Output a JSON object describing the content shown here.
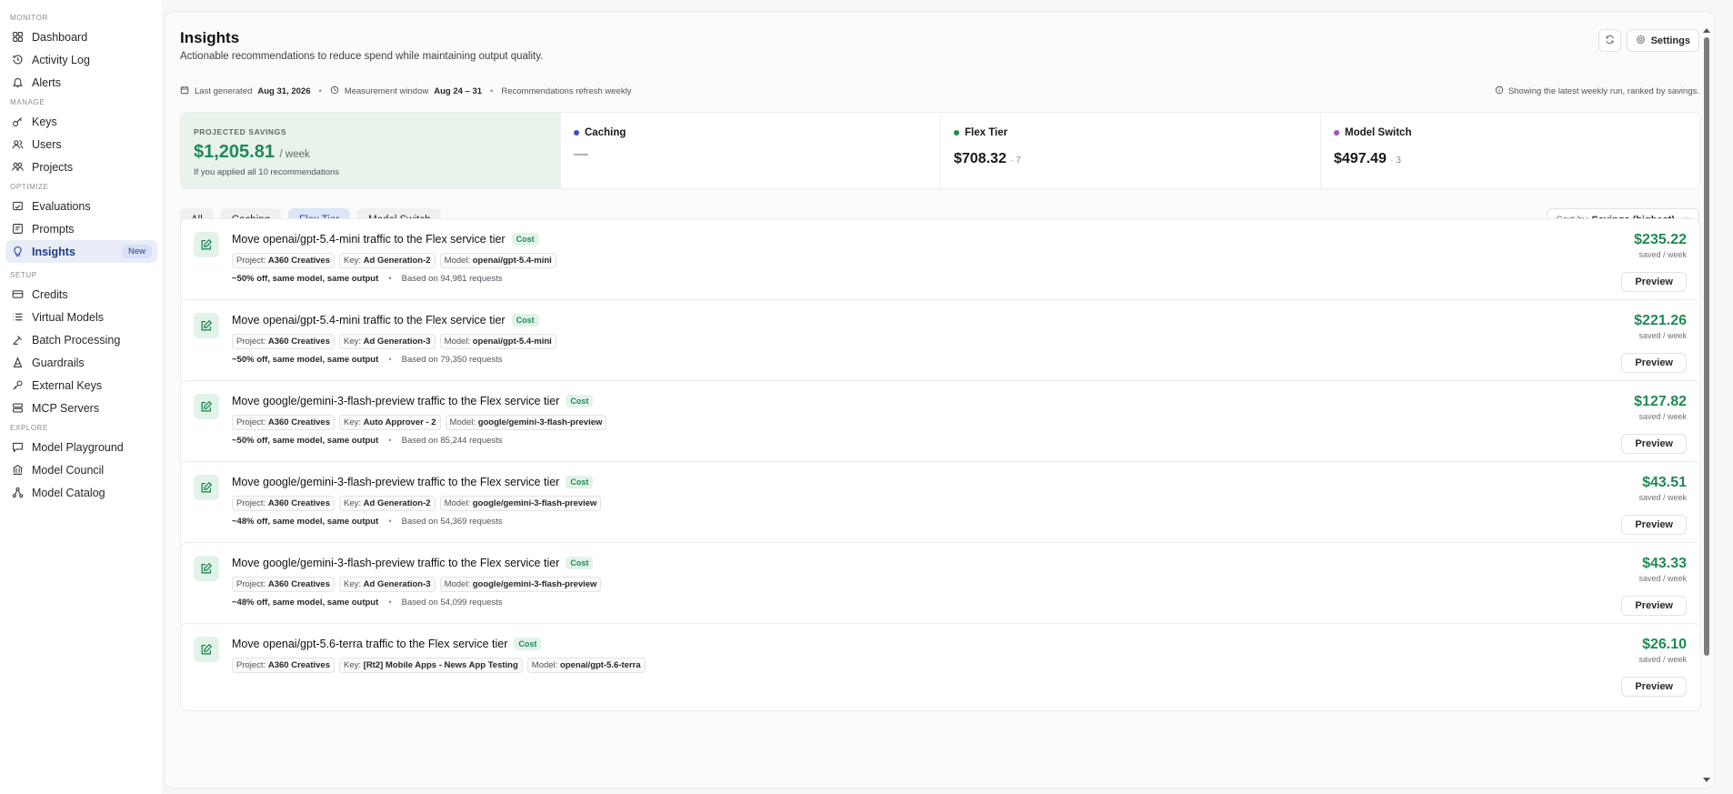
{
  "sidebar": {
    "sections": [
      {
        "title": "MONITOR",
        "items": [
          {
            "label": "Dashboard",
            "icon": "dashboard-icon"
          },
          {
            "label": "Activity Log",
            "icon": "history-icon"
          },
          {
            "label": "Alerts",
            "icon": "bell-icon"
          }
        ]
      },
      {
        "title": "MANAGE",
        "items": [
          {
            "label": "Keys",
            "icon": "key-icon"
          },
          {
            "label": "Users",
            "icon": "users-icon"
          },
          {
            "label": "Projects",
            "icon": "projects-icon"
          }
        ]
      },
      {
        "title": "OPTIMIZE",
        "items": [
          {
            "label": "Evaluations",
            "icon": "evaluations-icon"
          },
          {
            "label": "Prompts",
            "icon": "prompts-icon"
          },
          {
            "label": "Insights",
            "icon": "lightbulb-icon",
            "badge": "New",
            "active": true
          }
        ]
      },
      {
        "title": "SETUP",
        "items": [
          {
            "label": "Credits",
            "icon": "credit-card-icon"
          },
          {
            "label": "Virtual Models",
            "icon": "list-icon"
          },
          {
            "label": "Batch Processing",
            "icon": "batch-icon"
          },
          {
            "label": "Guardrails",
            "icon": "guardrails-icon"
          },
          {
            "label": "External Keys",
            "icon": "external-key-icon"
          },
          {
            "label": "MCP Servers",
            "icon": "server-icon"
          }
        ]
      },
      {
        "title": "EXPLORE",
        "items": [
          {
            "label": "Model Playground",
            "icon": "chat-icon"
          },
          {
            "label": "Model Council",
            "icon": "council-icon"
          },
          {
            "label": "Model Catalog",
            "icon": "catalog-icon"
          }
        ]
      }
    ]
  },
  "header": {
    "title": "Insights",
    "subtitle": "Actionable recommendations to reduce spend while maintaining output quality.",
    "settings_label": "Settings"
  },
  "meta": {
    "last_generated_label": "Last generated",
    "last_generated_value": "Aug 31, 2026",
    "window_label": "Measurement window",
    "window_value": "Aug 24 – 31",
    "refresh_note": "Recommendations refresh weekly",
    "right_note": "Showing the latest weekly run, ranked by savings."
  },
  "summary": {
    "projected_label": "PROJECTED SAVINGS",
    "projected_value": "$1,205.81",
    "projected_unit": "/ week",
    "projected_note": "If you applied all 10 recommendations",
    "categories": [
      {
        "name": "Caching",
        "value": "—",
        "count": "",
        "color": "#3b4fc4"
      },
      {
        "name": "Flex Tier",
        "value": "$708.32",
        "count": "· 7",
        "color": "#1f8a54"
      },
      {
        "name": "Model Switch",
        "value": "$497.49",
        "count": "· 3",
        "color": "#a34fc7"
      }
    ]
  },
  "tabs": [
    {
      "label": "All"
    },
    {
      "label": "Caching"
    },
    {
      "label": "Flex Tier",
      "active": true
    },
    {
      "label": "Model Switch"
    }
  ],
  "sort": {
    "prefix": "Sort by",
    "value": "Savings (highest)"
  },
  "recommendations": [
    {
      "title": "Move openai/gpt-5.4-mini traffic to the Flex service tier",
      "badge": "Cost",
      "project": "A360 Creatives",
      "key": "Ad Generation-2",
      "model": "openai/gpt-5.4-mini",
      "note": "~50% off, same model, same output",
      "based_on": "Based on 94,981 requests",
      "saved": "$235.22",
      "saved_unit": "saved / week",
      "preview": "Preview"
    },
    {
      "title": "Move openai/gpt-5.4-mini traffic to the Flex service tier",
      "badge": "Cost",
      "project": "A360 Creatives",
      "key": "Ad Generation-3",
      "model": "openai/gpt-5.4-mini",
      "note": "~50% off, same model, same output",
      "based_on": "Based on 79,350 requests",
      "saved": "$221.26",
      "saved_unit": "saved / week",
      "preview": "Preview"
    },
    {
      "title": "Move google/gemini-3-flash-preview traffic to the Flex service tier",
      "badge": "Cost",
      "project": "A360 Creatives",
      "key": "Auto Approver - 2",
      "model": "google/gemini-3-flash-preview",
      "note": "~50% off, same model, same output",
      "based_on": "Based on 85,244 requests",
      "saved": "$127.82",
      "saved_unit": "saved / week",
      "preview": "Preview"
    },
    {
      "title": "Move google/gemini-3-flash-preview traffic to the Flex service tier",
      "badge": "Cost",
      "project": "A360 Creatives",
      "key": "Ad Generation-2",
      "model": "google/gemini-3-flash-preview",
      "note": "~48% off, same model, same output",
      "based_on": "Based on 54,369 requests",
      "saved": "$43.51",
      "saved_unit": "saved / week",
      "preview": "Preview"
    },
    {
      "title": "Move google/gemini-3-flash-preview traffic to the Flex service tier",
      "badge": "Cost",
      "project": "A360 Creatives",
      "key": "Ad Generation-3",
      "model": "google/gemini-3-flash-preview",
      "note": "~48% off, same model, same output",
      "based_on": "Based on 54,099 requests",
      "saved": "$43.33",
      "saved_unit": "saved / week",
      "preview": "Preview"
    },
    {
      "title": "Move openai/gpt-5.6-terra traffic to the Flex service tier",
      "badge": "Cost",
      "project": "A360 Creatives",
      "key": "[Rt2] Mobile Apps - News App Testing",
      "model": "openai/gpt-5.6-terra",
      "note": "",
      "based_on": "",
      "saved": "$26.10",
      "saved_unit": "saved / week",
      "preview": "Preview"
    }
  ],
  "labels": {
    "project": "Project:",
    "key": "Key:",
    "model": "Model:"
  }
}
